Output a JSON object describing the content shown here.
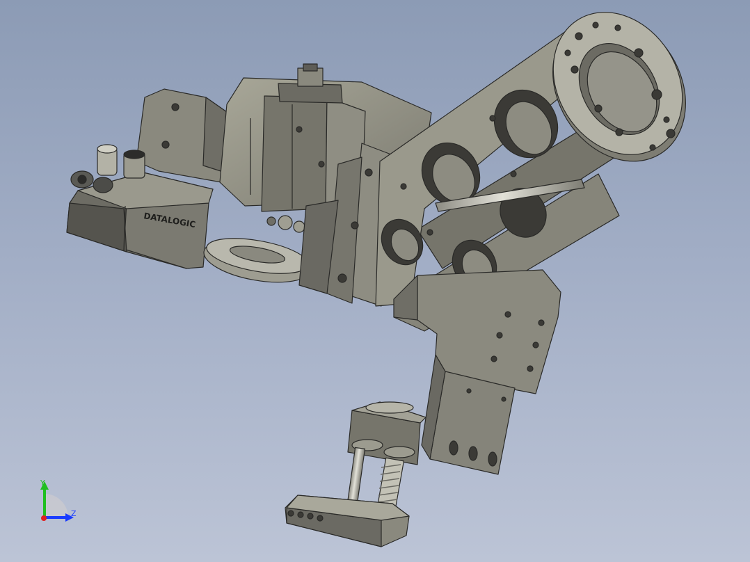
{
  "viewport": {
    "brand_label": "DATALOGIC",
    "triad": {
      "y_label": "Y",
      "z_label": "Z",
      "y_color": "#1fbf1f",
      "z_color": "#1a3cff",
      "x_color": "#e02020"
    }
  },
  "colors": {
    "metal_light": "#9c9b8c",
    "metal_mid": "#85847a",
    "metal_dark": "#5e5d57",
    "edge": "#2a2a28",
    "hole_dark": "#3b3a36",
    "hole_light": "#8e8d82",
    "shaft": "#c7c6bc"
  }
}
